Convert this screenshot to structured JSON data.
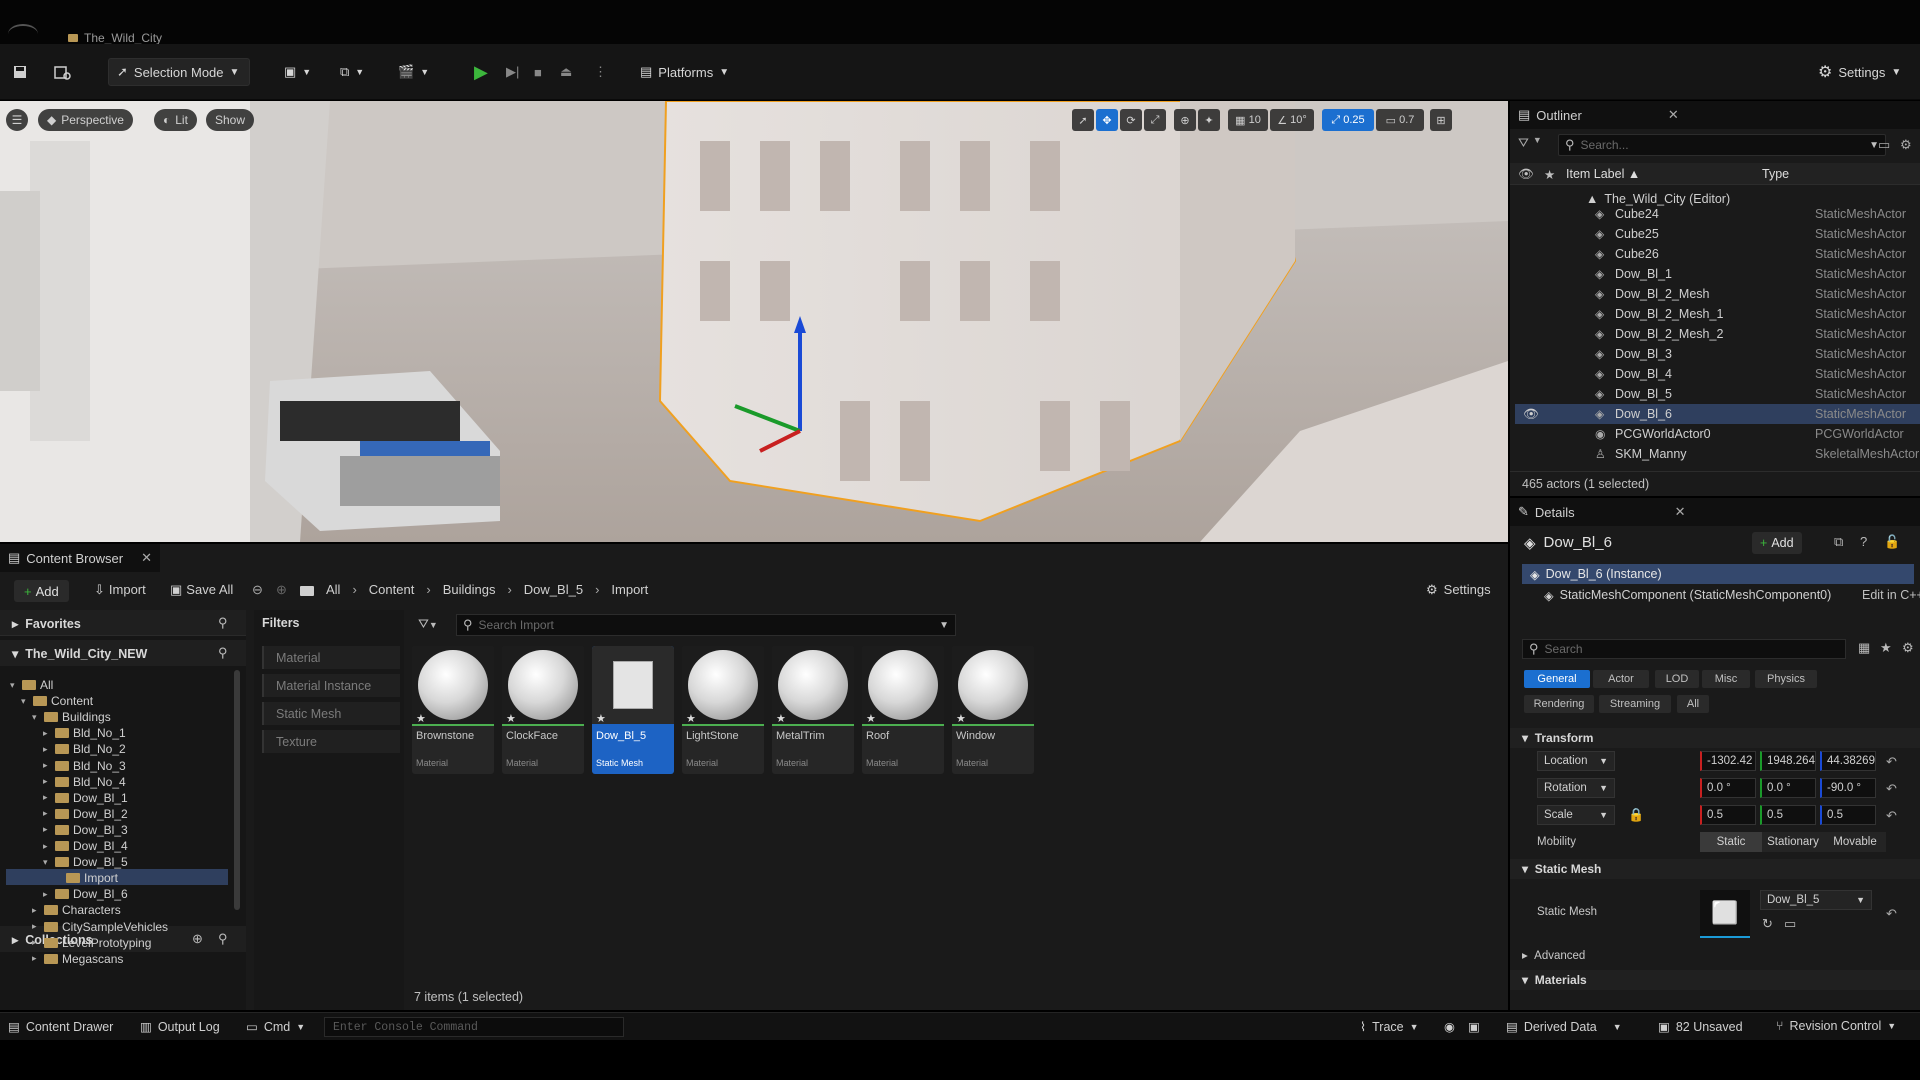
{
  "app": {
    "project_tab": "The_Wild_City"
  },
  "toolbar": {
    "selection_mode": "Selection Mode",
    "platforms": "Platforms",
    "settings": "Settings"
  },
  "viewport": {
    "perspective": "Perspective",
    "lit": "Lit",
    "show": "Show",
    "grid_snap": "10",
    "angle_snap": "10°",
    "scale_snap": "0.25",
    "camera_speed": "0.7"
  },
  "outliner": {
    "title": "Outliner",
    "search_placeholder": "Search...",
    "col_label": "Item Label",
    "col_type": "Type",
    "root": "The_Wild_City (Editor)",
    "rows": [
      {
        "label": "Cube24",
        "type": "StaticMeshActor"
      },
      {
        "label": "Cube25",
        "type": "StaticMeshActor"
      },
      {
        "label": "Cube26",
        "type": "StaticMeshActor"
      },
      {
        "label": "Dow_Bl_1",
        "type": "StaticMeshActor"
      },
      {
        "label": "Dow_Bl_2_Mesh",
        "type": "StaticMeshActor"
      },
      {
        "label": "Dow_Bl_2_Mesh_1",
        "type": "StaticMeshActor"
      },
      {
        "label": "Dow_Bl_2_Mesh_2",
        "type": "StaticMeshActor"
      },
      {
        "label": "Dow_Bl_3",
        "type": "StaticMeshActor"
      },
      {
        "label": "Dow_Bl_4",
        "type": "StaticMeshActor"
      },
      {
        "label": "Dow_Bl_5",
        "type": "StaticMeshActor"
      },
      {
        "label": "Dow_Bl_6",
        "type": "StaticMeshActor"
      },
      {
        "label": "PCGWorldActor0",
        "type": "PCGWorldActor"
      },
      {
        "label": "SKM_Manny",
        "type": "SkeletalMeshActor"
      }
    ],
    "count": "465 actors (1 selected)"
  },
  "details": {
    "title": "Details",
    "actor_name": "Dow_Bl_6",
    "add": "Add",
    "instance": "Dow_Bl_6 (Instance)",
    "component": "StaticMeshComponent (StaticMeshComponent0)",
    "edit_cpp": "Edit in C++",
    "search_placeholder": "Search",
    "tabs": [
      "General",
      "Actor",
      "LOD",
      "Misc",
      "Physics",
      "Rendering",
      "Streaming",
      "All"
    ],
    "transform": "Transform",
    "location_label": "Location",
    "location": [
      "-1302.42",
      "1948.264",
      "44.38269"
    ],
    "rotation_label": "Rotation",
    "rotation": [
      "0.0 °",
      "0.0 °",
      "-90.0 °"
    ],
    "scale_label": "Scale",
    "scale": [
      "0.5",
      "0.5",
      "0.5"
    ],
    "mobility_label": "Mobility",
    "mobility": [
      "Static",
      "Stationary",
      "Movable"
    ],
    "static_mesh_section": "Static Mesh",
    "static_mesh_label": "Static Mesh",
    "static_mesh_value": "Dow_Bl_5",
    "advanced": "Advanced",
    "materials": "Materials"
  },
  "content_browser": {
    "title": "Content Browser",
    "add": "Add",
    "import": "Import",
    "save_all": "Save All",
    "breadcrumb": [
      "All",
      "Content",
      "Buildings",
      "Dow_Bl_5",
      "Import"
    ],
    "settings": "Settings",
    "favorites": "Favorites",
    "project": "The_Wild_City_NEW",
    "tree": [
      {
        "label": "All",
        "depth": 0
      },
      {
        "label": "Content",
        "depth": 1
      },
      {
        "label": "Buildings",
        "depth": 2
      },
      {
        "label": "Bld_No_1",
        "depth": 3
      },
      {
        "label": "Bld_No_2",
        "depth": 3
      },
      {
        "label": "Bld_No_3",
        "depth": 3
      },
      {
        "label": "Bld_No_4",
        "depth": 3
      },
      {
        "label": "Dow_Bl_1",
        "depth": 3
      },
      {
        "label": "Dow_Bl_2",
        "depth": 3
      },
      {
        "label": "Dow_Bl_3",
        "depth": 3
      },
      {
        "label": "Dow_Bl_4",
        "depth": 3
      },
      {
        "label": "Dow_Bl_5",
        "depth": 3
      },
      {
        "label": "Import",
        "depth": 4
      },
      {
        "label": "Dow_Bl_6",
        "depth": 3
      },
      {
        "label": "Characters",
        "depth": 2
      },
      {
        "label": "CitySampleVehicles",
        "depth": 2
      },
      {
        "label": "LevelPrototyping",
        "depth": 2
      },
      {
        "label": "Megascans",
        "depth": 2
      }
    ],
    "collections": "Collections",
    "filters": "Filters",
    "filter_items": [
      "Material",
      "Material Instance",
      "Static Mesh",
      "Texture"
    ],
    "search_placeholder": "Search Import",
    "assets": [
      {
        "name": "Brownstone",
        "kind": "Material"
      },
      {
        "name": "ClockFace",
        "kind": "Material"
      },
      {
        "name": "Dow_Bl_5",
        "kind": "Static Mesh"
      },
      {
        "name": "LightStone",
        "kind": "Material"
      },
      {
        "name": "MetalTrim",
        "kind": "Material"
      },
      {
        "name": "Roof",
        "kind": "Material"
      },
      {
        "name": "Window",
        "kind": "Material"
      }
    ],
    "count": "7 items (1 selected)"
  },
  "statusbar": {
    "content_drawer": "Content Drawer",
    "output_log": "Output Log",
    "cmd": "Cmd",
    "console_placeholder": "Enter Console Command",
    "trace": "Trace",
    "derived_data": "Derived Data",
    "unsaved": "82 Unsaved",
    "revision_control": "Revision Control"
  }
}
